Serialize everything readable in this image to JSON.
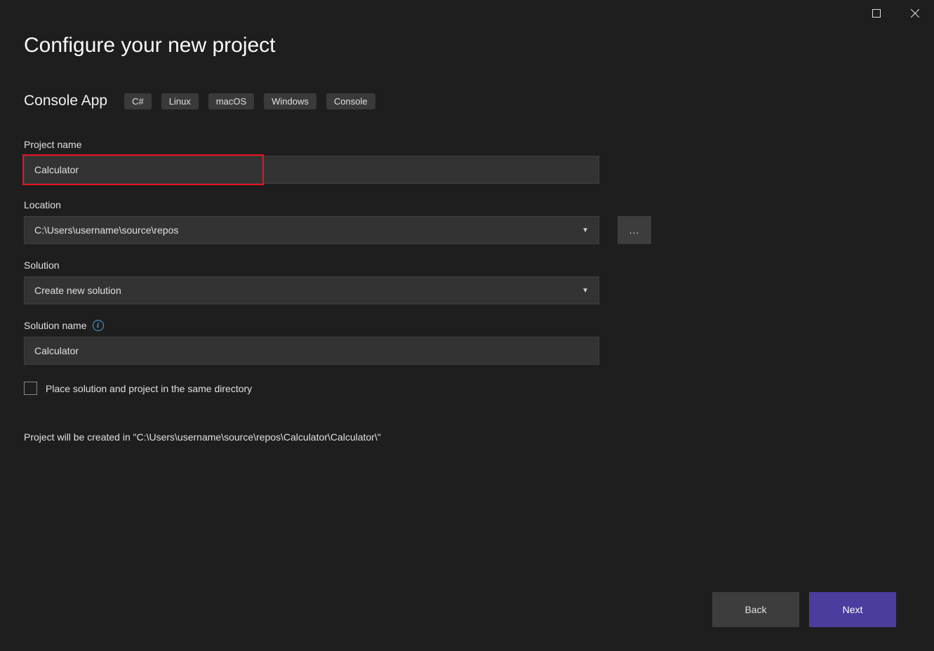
{
  "page_title": "Configure your new project",
  "template": {
    "name": "Console App",
    "tags": [
      "C#",
      "Linux",
      "macOS",
      "Windows",
      "Console"
    ]
  },
  "fields": {
    "project_name": {
      "label": "Project name",
      "value": "Calculator"
    },
    "location": {
      "label": "Location",
      "value": "C:\\Users\\username\\source\\repos",
      "browse": "..."
    },
    "solution": {
      "label": "Solution",
      "value": "Create new solution"
    },
    "solution_name": {
      "label": "Solution name",
      "value": "Calculator"
    }
  },
  "checkbox": {
    "label": "Place solution and project in the same directory"
  },
  "info_text": "Project will be created in \"C:\\Users\\username\\source\\repos\\Calculator\\Calculator\\\"",
  "footer": {
    "back": "Back",
    "next": "Next"
  }
}
